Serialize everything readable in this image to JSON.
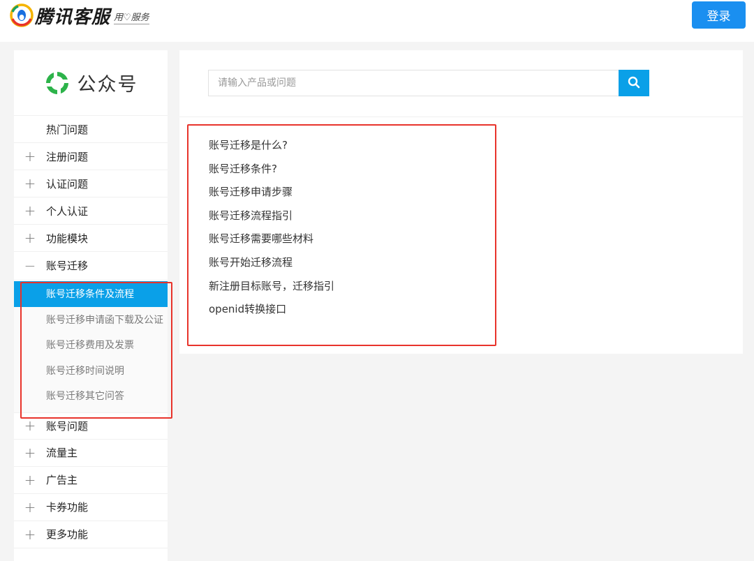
{
  "header": {
    "logo_title": "腾讯客服",
    "logo_slogan": "用♡服务",
    "login_label": "登录"
  },
  "sidebar": {
    "brand_label": "公众号",
    "items": [
      {
        "sign": "",
        "label": "热门问题"
      },
      {
        "sign": "+",
        "label": "注册问题"
      },
      {
        "sign": "+",
        "label": "认证问题"
      },
      {
        "sign": "+",
        "label": "个人认证"
      },
      {
        "sign": "+",
        "label": "功能模块"
      },
      {
        "sign": "−",
        "label": "账号迁移"
      }
    ],
    "sub_items": [
      {
        "label": "账号迁移条件及流程"
      },
      {
        "label": "账号迁移申请函下载及公证"
      },
      {
        "label": "账号迁移费用及发票"
      },
      {
        "label": "账号迁移时间说明"
      },
      {
        "label": "账号迁移其它问答"
      }
    ],
    "items_after": [
      {
        "sign": "+",
        "label": "账号问题"
      },
      {
        "sign": "+",
        "label": "流量主"
      },
      {
        "sign": "+",
        "label": "广告主"
      },
      {
        "sign": "+",
        "label": "卡券功能"
      },
      {
        "sign": "+",
        "label": "更多功能"
      }
    ]
  },
  "search": {
    "placeholder": "请输入产品或问题",
    "value": ""
  },
  "questions": [
    {
      "label": "账号迁移是什么?"
    },
    {
      "label": "账号迁移条件?"
    },
    {
      "label": "账号迁移申请步骤"
    },
    {
      "label": "账号迁移流程指引"
    },
    {
      "label": "账号迁移需要哪些材料"
    },
    {
      "label": "账号开始迁移流程"
    },
    {
      "label": "新注册目标账号，迁移指引"
    },
    {
      "label": "openid转换接口"
    }
  ],
  "colors": {
    "accent": "#0aa0e8",
    "login": "#1a8ff0",
    "highlight": "#e8332b"
  }
}
